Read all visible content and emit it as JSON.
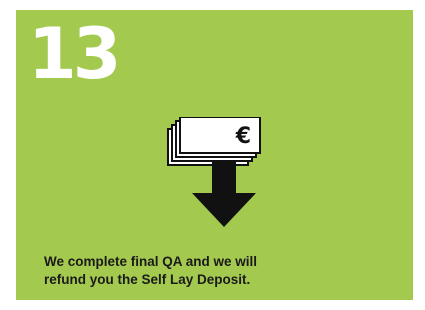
{
  "step": {
    "number": "13",
    "description_lines": [
      "We complete final QA and we will",
      "refund you the Self Lay Deposit."
    ]
  },
  "icon": {
    "name": "euro-refund-icon",
    "currency_symbol": "€"
  },
  "colors": {
    "card_background": "#a4c94f",
    "number": "#ffffff",
    "text": "#1a1a1a",
    "icon_dark": "#111111"
  }
}
